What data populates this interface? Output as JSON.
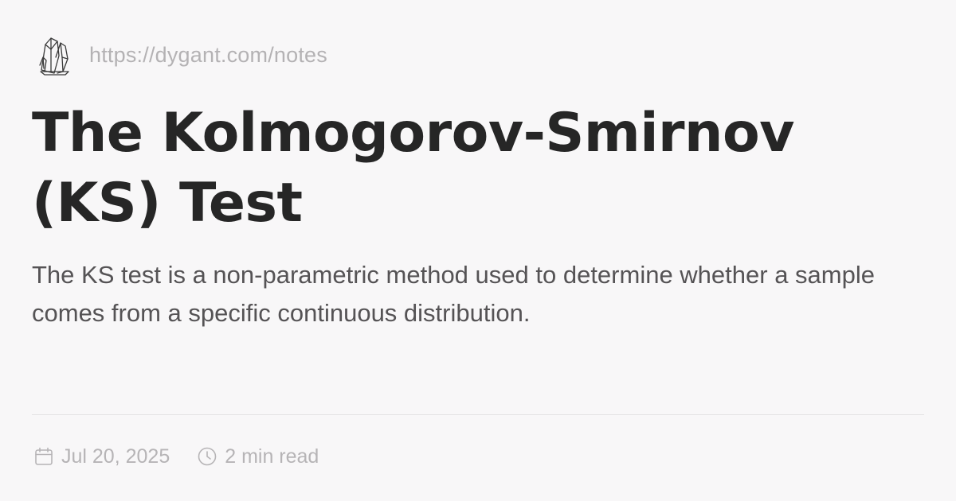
{
  "site": {
    "logo_icon": "crystal-cluster-icon",
    "url": "https://dygant.com/notes"
  },
  "post": {
    "title": "The Kolmogorov-Smirnov (KS) Test",
    "description": "The KS test is a non-parametric method used to determine whether a sample comes from a specific continuous distribution.",
    "date": "Jul 20, 2025",
    "date_icon": "calendar-icon",
    "read_time": "2 min read",
    "read_time_icon": "clock-icon"
  },
  "colors": {
    "background": "#f8f7f8",
    "title": "#262626",
    "description": "#555355",
    "muted": "#b4b2b4",
    "divider": "#e4e2e4"
  }
}
